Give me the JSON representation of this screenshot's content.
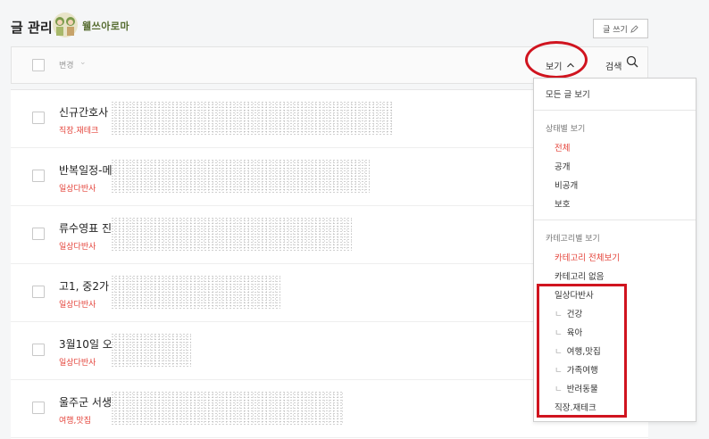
{
  "header": {
    "title": "글 관리",
    "blog_name": "웰쓰아로마",
    "write_button": "글 쓰기"
  },
  "toolbar": {
    "change_label": "변경",
    "view_label": "보기",
    "search_label": "검색"
  },
  "posts": [
    {
      "title": "신규간호사",
      "category": "직장.재테크"
    },
    {
      "title": "반복일정-메",
      "category": "일상다반사"
    },
    {
      "title": "류수영표 진",
      "category": "일상다반사"
    },
    {
      "title": "고1, 중2가",
      "category": "일상다반사"
    },
    {
      "title": "3월10일 오",
      "category": "일상다반사"
    },
    {
      "title": "울주군 서생",
      "category": "여행,맛집"
    }
  ],
  "dropdown": {
    "all_posts": "모든 글 보기",
    "status_header": "상태별 보기",
    "status_items": [
      "전체",
      "공개",
      "비공개",
      "보호"
    ],
    "category_header": "카테고리별 보기",
    "category_all": "카테고리 전체보기",
    "category_none": "카테고리 없음",
    "category_parent": "일상다반사",
    "category_children": [
      "건강",
      "육아",
      "여행,맛집",
      "가족여행",
      "반려동물"
    ],
    "category_last": "직장.재테크"
  },
  "colors": {
    "accent_red": "#e4433a",
    "annotation_red": "#d0141f"
  }
}
